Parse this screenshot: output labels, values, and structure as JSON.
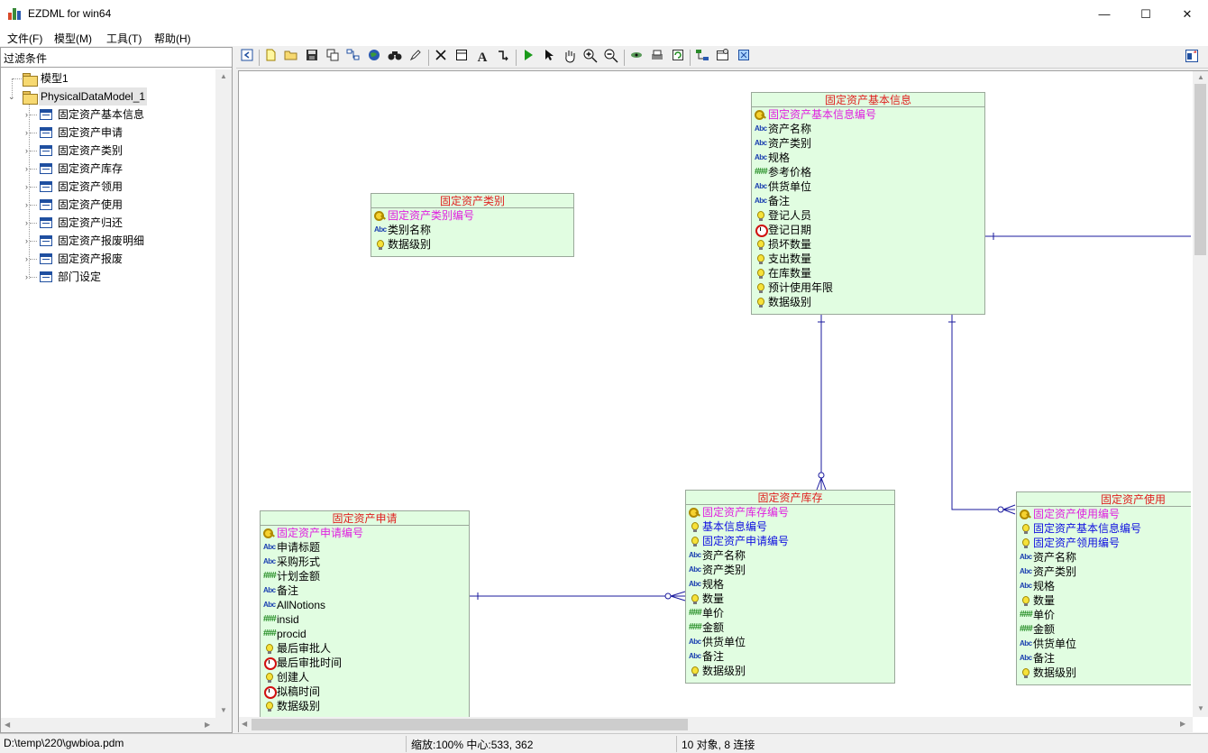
{
  "window": {
    "title": "EZDML for win64",
    "min_glyph": "—",
    "max_glyph": "☐",
    "close_glyph": "✕"
  },
  "menu": [
    {
      "label": "文件(F)"
    },
    {
      "label": "模型(M)"
    },
    {
      "label": "工具(T)"
    },
    {
      "label": "帮助(H)"
    }
  ],
  "left": {
    "filter_label": "过滤条件",
    "tree": {
      "model": "模型1",
      "pdm": "PhysicalDataModel_1",
      "tables": [
        "固定资产基本信息",
        "固定资产申请",
        "固定资产类别",
        "固定资产库存",
        "固定资产领用",
        "固定资产使用",
        "固定资产归还",
        "固定资产报废明细",
        "固定资产报废",
        "部门设定"
      ]
    }
  },
  "toolbar": {
    "icons": [
      "back-icon",
      "new-icon",
      "open-icon",
      "save-icon",
      "copy-model-icon",
      "layout-icon",
      "globe-icon",
      "find-icon",
      "pen-icon",
      "delete-icon",
      "table-icon",
      "text-icon",
      "link-icon",
      "run-icon",
      "pointer-icon",
      "hand-icon",
      "zoom-in-icon",
      "zoom-out-icon",
      "eye-icon",
      "print-icon",
      "refresh-icon",
      "tree-icon",
      "properties-icon",
      "fit-icon"
    ],
    "right_icon": "panel-toggle-icon"
  },
  "entities": {
    "e1": {
      "title": "固定资产基本信息",
      "fields": [
        {
          "name": "固定资产基本信息编号",
          "kind": "pk",
          "icon": "key-icon"
        },
        {
          "name": "资产名称",
          "kind": "",
          "icon": "abc-icon"
        },
        {
          "name": "资产类别",
          "kind": "",
          "icon": "abc-icon"
        },
        {
          "name": "规格",
          "kind": "",
          "icon": "abc-icon"
        },
        {
          "name": "参考价格",
          "kind": "",
          "icon": "number-icon"
        },
        {
          "name": "供货单位",
          "kind": "",
          "icon": "abc-icon"
        },
        {
          "name": "备注",
          "kind": "",
          "icon": "abc-icon"
        },
        {
          "name": "登记人员",
          "kind": "",
          "icon": "bulb-icon"
        },
        {
          "name": "登记日期",
          "kind": "",
          "icon": "clock-icon"
        },
        {
          "name": "损坏数量",
          "kind": "",
          "icon": "bulb-icon"
        },
        {
          "name": "支出数量",
          "kind": "",
          "icon": "bulb-icon"
        },
        {
          "name": "在库数量",
          "kind": "",
          "icon": "bulb-icon"
        },
        {
          "name": "预计使用年限",
          "kind": "",
          "icon": "bulb-icon"
        },
        {
          "name": "数据级别",
          "kind": "",
          "icon": "bulb-icon"
        }
      ]
    },
    "e2": {
      "title": "固定资产类别",
      "fields": [
        {
          "name": "固定资产类别编号",
          "kind": "pk",
          "icon": "key-icon"
        },
        {
          "name": "类别名称",
          "kind": "",
          "icon": "abc-icon"
        },
        {
          "name": "数据级别",
          "kind": "",
          "icon": "bulb-icon"
        }
      ]
    },
    "e3": {
      "title": "固定资产申请",
      "fields": [
        {
          "name": "固定资产申请编号",
          "kind": "pk",
          "icon": "key-icon"
        },
        {
          "name": "申请标题",
          "kind": "",
          "icon": "abc-icon"
        },
        {
          "name": "采购形式",
          "kind": "",
          "icon": "abc-icon"
        },
        {
          "name": "计划金额",
          "kind": "",
          "icon": "number-icon"
        },
        {
          "name": "备注",
          "kind": "",
          "icon": "abc-icon"
        },
        {
          "name": "AllNotions",
          "kind": "",
          "icon": "abc-icon"
        },
        {
          "name": "insid",
          "kind": "",
          "icon": "number-icon"
        },
        {
          "name": "procid",
          "kind": "",
          "icon": "number-icon"
        },
        {
          "name": "最后审批人",
          "kind": "",
          "icon": "bulb-icon"
        },
        {
          "name": "最后审批时间",
          "kind": "",
          "icon": "clock-icon"
        },
        {
          "name": "创建人",
          "kind": "",
          "icon": "bulb-icon"
        },
        {
          "name": "拟稿时间",
          "kind": "",
          "icon": "clock-icon"
        },
        {
          "name": "数据级别",
          "kind": "",
          "icon": "bulb-icon"
        }
      ]
    },
    "e4": {
      "title": "固定资产库存",
      "fields": [
        {
          "name": "固定资产库存编号",
          "kind": "pk",
          "icon": "key-icon"
        },
        {
          "name": "基本信息编号",
          "kind": "fk",
          "icon": "bulb-icon"
        },
        {
          "name": "固定资产申请编号",
          "kind": "fk",
          "icon": "bulb-icon"
        },
        {
          "name": "资产名称",
          "kind": "",
          "icon": "abc-icon"
        },
        {
          "name": "资产类别",
          "kind": "",
          "icon": "abc-icon"
        },
        {
          "name": "规格",
          "kind": "",
          "icon": "abc-icon"
        },
        {
          "name": "数量",
          "kind": "",
          "icon": "bulb-icon"
        },
        {
          "name": "单价",
          "kind": "",
          "icon": "number-icon"
        },
        {
          "name": "金额",
          "kind": "",
          "icon": "number-icon"
        },
        {
          "name": "供货单位",
          "kind": "",
          "icon": "abc-icon"
        },
        {
          "name": "备注",
          "kind": "",
          "icon": "abc-icon"
        },
        {
          "name": "数据级别",
          "kind": "",
          "icon": "bulb-icon"
        }
      ]
    },
    "e5": {
      "title": "固定资产使用",
      "fields": [
        {
          "name": "固定资产使用编号",
          "kind": "pk",
          "icon": "key-icon"
        },
        {
          "name": "固定资产基本信息编号",
          "kind": "fk",
          "icon": "bulb-icon"
        },
        {
          "name": "固定资产领用编号",
          "kind": "fk",
          "icon": "bulb-icon"
        },
        {
          "name": "资产名称",
          "kind": "",
          "icon": "abc-icon"
        },
        {
          "name": "资产类别",
          "kind": "",
          "icon": "abc-icon"
        },
        {
          "name": "规格",
          "kind": "",
          "icon": "abc-icon"
        },
        {
          "name": "数量",
          "kind": "",
          "icon": "bulb-icon"
        },
        {
          "name": "单价",
          "kind": "",
          "icon": "number-icon"
        },
        {
          "name": "金额",
          "kind": "",
          "icon": "number-icon"
        },
        {
          "name": "供货单位",
          "kind": "",
          "icon": "abc-icon"
        },
        {
          "name": "备注",
          "kind": "",
          "icon": "abc-icon"
        },
        {
          "name": "数据级别",
          "kind": "",
          "icon": "bulb-icon"
        }
      ]
    }
  },
  "status": {
    "path": "D:\\temp\\220\\gwbioa.pdm",
    "zoom": "缩放:100% 中心:533, 362",
    "counts": "10 对象, 8 连接"
  },
  "colors": {
    "entity_bg": "#e1fde1",
    "entity_title": "#e02020",
    "pk": "#e020e0",
    "fk": "#1010e0",
    "link": "#1a1a9e"
  }
}
